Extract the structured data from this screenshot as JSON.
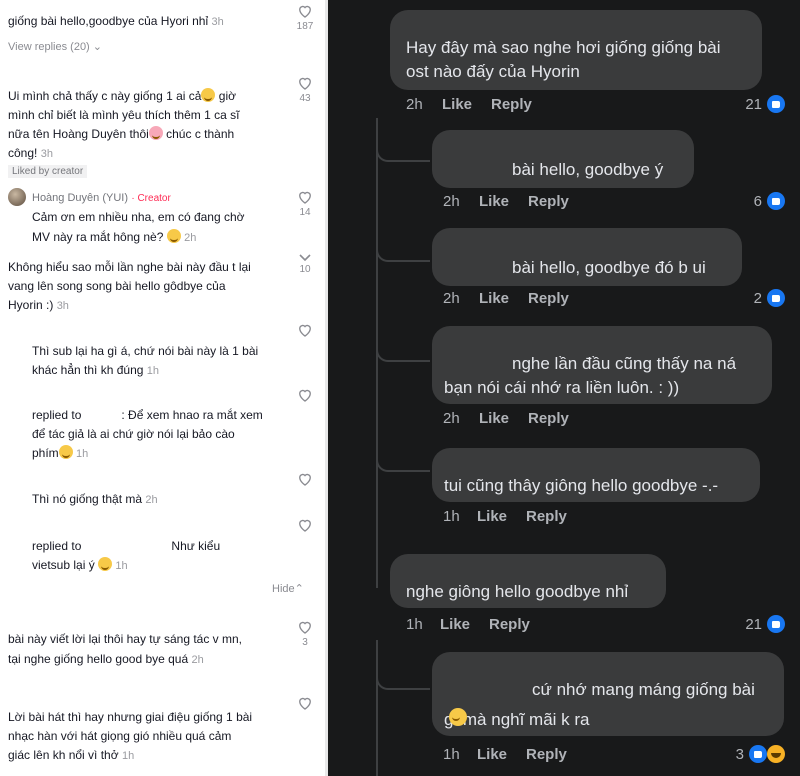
{
  "left": {
    "c0": {
      "text": "giống bài hello,goodbye của Hyori nhỉ",
      "time": "3h",
      "likes": "187",
      "view_replies": "View replies (20)"
    },
    "c1": {
      "line1": "Ui mình chả thấy c này giống 1 ai cả",
      "line1b": " giờ",
      "line2": "mình chỉ biết là mình yêu thích thêm 1 ca sĩ",
      "line3": "nữa tên Hoàng Duyên thôi",
      "line3b": " chúc c thành",
      "line4": "công!",
      "time": "3h",
      "likes": "43",
      "liked_by": "Liked by creator"
    },
    "c2": {
      "author": "Hoàng Duyên (YUI)",
      "badge": "· Creator",
      "line1": "Cảm ơn em nhiều nha, em có đang chờ",
      "line2": "MV này ra mắt hông nè?",
      "time": "2h",
      "likes": "14"
    },
    "c3": {
      "line1": "Không hiểu sao mỗi lần nghe bài này đầu t lại",
      "line2": "vang lên song song bài hello gôdbye của",
      "line3": "Hyorin :)",
      "time": "3h",
      "likes": "10"
    },
    "c4": {
      "line1": "Thì sub lại ha gì á, chứ nói bài này là 1 bài",
      "line2": "khác hẳn thì kh đúng",
      "time": "1h"
    },
    "c5": {
      "line1a": "replied to",
      "line1b": ": Để xem hnao ra mắt xem",
      "line2": "để tác giả là ai chứ giờ nói lại bảo cào",
      "line3": "phím",
      "time": "1h"
    },
    "c6": {
      "line1": "Thì nó giống thật mà",
      "time": "2h"
    },
    "c7": {
      "line1a": "replied to",
      "line1b": "Như kiểu",
      "line2": "vietsub lại ý",
      "time": "1h"
    },
    "hide": "Hide",
    "c8": {
      "line1": "bài này viết lời lại thôi hay tự sáng tác v mn,",
      "line2": "tại nghe giống hello good bye quá",
      "time": "2h",
      "likes": "3"
    },
    "c9": {
      "line1": "Lời bài hát thì hay nhưng giai điệu giống 1 bài",
      "line2": "nhạc hàn với hát giọng gió nhiều quá cảm",
      "line3": "giác lên kh nổi vì thở",
      "time": "1h"
    }
  },
  "right": {
    "comments": [
      {
        "line1": "Hay đây mà sao nghe hơi giống giống bài",
        "line2": "ost nào đấy của Hyorin",
        "time": "2h",
        "like": "Like",
        "reply": "Reply",
        "count": "21"
      },
      {
        "line1": "bài hello, goodbye ý",
        "time": "2h",
        "like": "Like",
        "reply": "Reply",
        "count": "6"
      },
      {
        "line1": "bài hello, goodbye đó b ui",
        "time": "2h",
        "like": "Like",
        "reply": "Reply",
        "count": "2"
      },
      {
        "line1": "nghe lần đầu cũng thấy na ná",
        "line2": "bạn nói cái nhớ ra liền luôn. : ))",
        "time": "2h",
        "like": "Like",
        "reply": "Reply"
      },
      {
        "line1": "tui cũng thây giông hello goodbye -.-",
        "time": "1h",
        "like": "Like",
        "reply": "Reply"
      },
      {
        "line1": "nghe giông hello goodbye nhỉ",
        "time": "1h",
        "like": "Like",
        "reply": "Reply",
        "count": "21"
      },
      {
        "line1": "cứ nhớ mang máng giống bài",
        "line2": "gì mà nghĩ mãi k ra",
        "time": "1h",
        "like": "Like",
        "reply": "Reply",
        "count": "3"
      }
    ]
  },
  "colors": {
    "fb_blue": "#1877f2",
    "tiktok_red": "#fe2c55",
    "fb_bg": "#18191a",
    "bubble": "#3a3b3c"
  }
}
